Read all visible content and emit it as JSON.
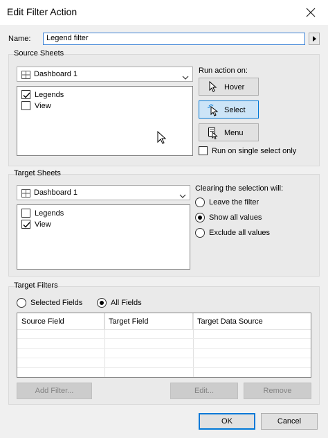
{
  "window": {
    "title": "Edit Filter Action",
    "close_icon": "close-icon"
  },
  "name_field": {
    "label": "Name:",
    "value": "Legend filter"
  },
  "source_sheets": {
    "group_title": "Source Sheets",
    "dashboard": "Dashboard 1",
    "items": [
      {
        "label": "Legends",
        "checked": true
      },
      {
        "label": "View",
        "checked": false
      }
    ],
    "run_action_label": "Run action on:",
    "actions": [
      {
        "label": "Hover",
        "icon": "pointer-icon",
        "active": false
      },
      {
        "label": "Select",
        "icon": "select-click-icon",
        "active": true
      },
      {
        "label": "Menu",
        "icon": "menu-doc-icon",
        "active": false
      }
    ],
    "single_select_label": "Run on single select only",
    "single_select_checked": false
  },
  "target_sheets": {
    "group_title": "Target Sheets",
    "dashboard": "Dashboard 1",
    "items": [
      {
        "label": "Legends",
        "checked": false
      },
      {
        "label": "View",
        "checked": true
      }
    ],
    "clearing_label": "Clearing the selection will:",
    "clearing_options": [
      {
        "label": "Leave the filter",
        "selected": false
      },
      {
        "label": "Show all values",
        "selected": true
      },
      {
        "label": "Exclude all values",
        "selected": false
      }
    ]
  },
  "target_filters": {
    "group_title": "Target Filters",
    "mode_options": [
      {
        "label": "Selected Fields",
        "selected": false
      },
      {
        "label": "All Fields",
        "selected": true
      }
    ],
    "columns": [
      "Source Field",
      "Target Field",
      "Target Data Source"
    ],
    "add_filter_label": "Add Filter...",
    "edit_label": "Edit...",
    "remove_label": "Remove"
  },
  "footer": {
    "ok_label": "OK",
    "cancel_label": "Cancel"
  },
  "colors": {
    "accent": "#0078d7",
    "selected_button_bg": "#cce4f7",
    "dialog_bg": "#f0f0f0"
  }
}
